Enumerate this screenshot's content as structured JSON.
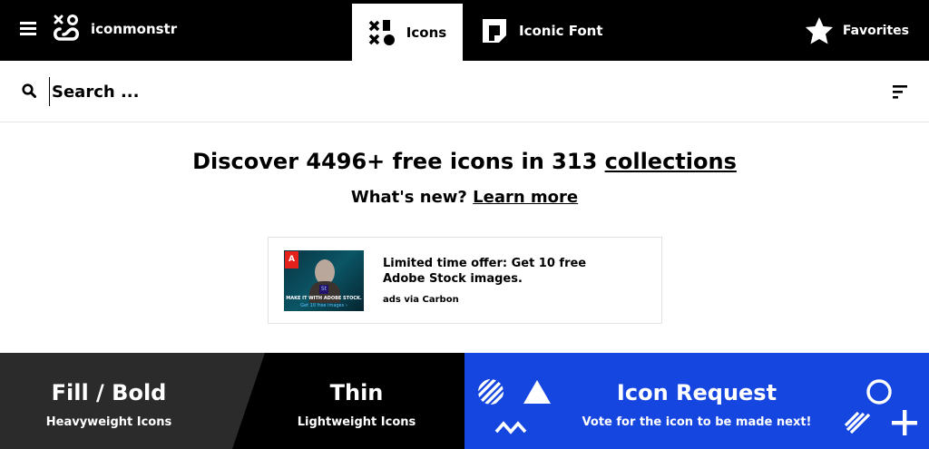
{
  "brand": {
    "name": "iconmonstr"
  },
  "nav": {
    "icons_label": "Icons",
    "font_label": "Iconic Font",
    "favorites_label": "Favorites"
  },
  "search": {
    "placeholder": "Search ..."
  },
  "hero": {
    "headline_prefix": "Discover 4496+ free icons in 313 ",
    "headline_link": "collections",
    "sub_prefix": "What's new? ",
    "sub_link": "Learn more"
  },
  "ad": {
    "logo_text": "A",
    "ps_text": "St",
    "image_caption": "MAKE IT WITH ADOBE STOCK.",
    "image_cta": "Get 10 free images ›",
    "text": "Limited time offer: Get 10 free Adobe Stock images.",
    "via": "ads via Carbon"
  },
  "tiles": {
    "fill": {
      "title": "Fill / Bold",
      "subtitle": "Heavyweight Icons"
    },
    "thin": {
      "title": "Thin",
      "subtitle": "Lightweight Icons"
    },
    "request": {
      "title": "Icon Request",
      "subtitle": "Vote for the icon to be made next!"
    }
  },
  "colors": {
    "topbar": "#000000",
    "fill_tile": "#2b2b2b",
    "thin_tile": "#000000",
    "request_tile": "#1646e0"
  },
  "icons": [
    "menu-icon",
    "iconmonstr-logo-icon",
    "shapes-icon",
    "iconic-font-icon",
    "star-icon",
    "search-icon",
    "filter-icon"
  ]
}
